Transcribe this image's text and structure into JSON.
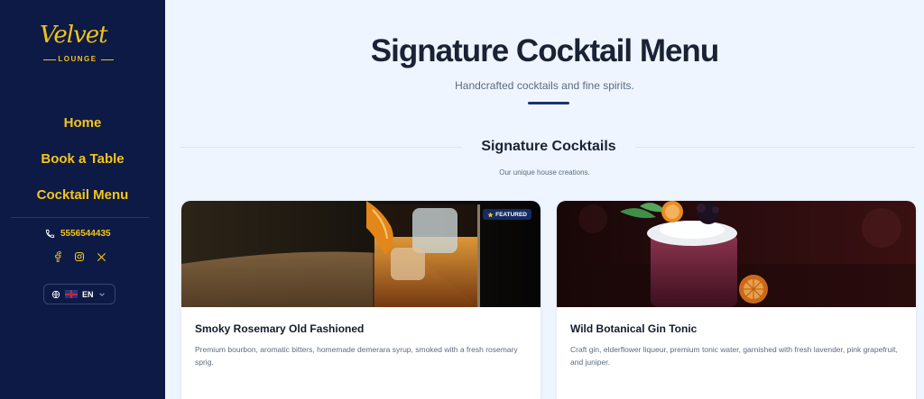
{
  "brand": {
    "script": "Velvet",
    "sub": "LOUNGE"
  },
  "nav": [
    {
      "label": "Home"
    },
    {
      "label": "Book a Table"
    },
    {
      "label": "Cocktail Menu"
    }
  ],
  "contact": {
    "phone": "5556544435"
  },
  "socials": [
    "facebook-icon",
    "instagram-icon",
    "x-icon"
  ],
  "language": {
    "code": "EN"
  },
  "page": {
    "title": "Signature Cocktail Menu",
    "subtitle": "Handcrafted cocktails and fine spirits."
  },
  "section": {
    "title": "Signature Cocktails",
    "subtitle": "Our unique house creations."
  },
  "cards": [
    {
      "title": "Smoky Rosemary Old Fashioned",
      "description": "Premium bourbon, aromatic bitters, homemade demerara syrup, smoked with a fresh rosemary sprig.",
      "badge": "FEATURED"
    },
    {
      "title": "Wild Botanical Gin Tonic",
      "description": "Craft gin, elderflower liqueur, premium tonic water, garnished with fresh lavender, pink grapefruit, and juniper."
    }
  ],
  "colors": {
    "sidebar_bg": "#0c1a45",
    "accent_gold": "#f5c518",
    "page_bg": "#eef5fe",
    "heading": "#1a2235",
    "underline": "#1a3170"
  }
}
